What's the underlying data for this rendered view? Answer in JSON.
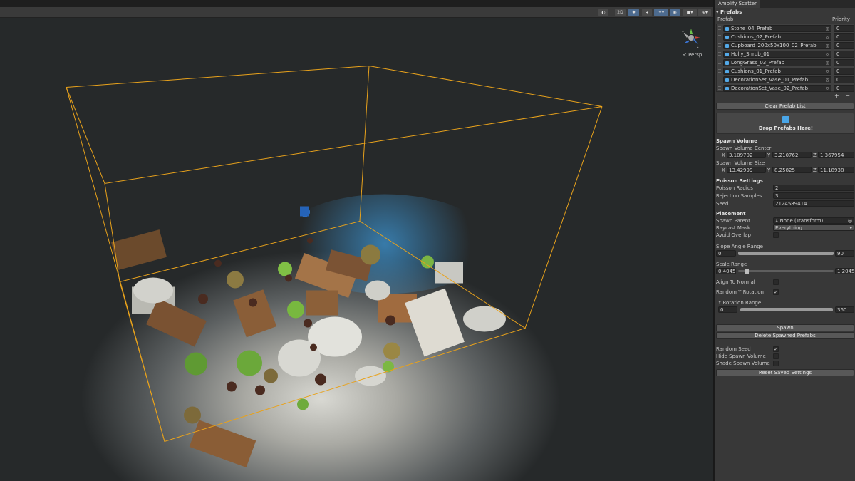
{
  "scene": {
    "toolbar": {
      "mode_2d": "2D"
    },
    "persp_label": "≺ Persp",
    "gizmo_axes": {
      "y": "y",
      "z": "z"
    }
  },
  "panel": {
    "tab_title": "Amplify Scatter",
    "prefabs": {
      "foldout_label": "Prefabs",
      "col_prefab": "Prefab",
      "col_priority": "Priority",
      "items": [
        {
          "name": "Stone_04_Prefab",
          "priority": "0"
        },
        {
          "name": "Cushions_02_Prefab",
          "priority": "0"
        },
        {
          "name": "Cupboard_200x50x100_02_Prefab",
          "priority": "0"
        },
        {
          "name": "Holly_Shrub_01",
          "priority": "0"
        },
        {
          "name": "LongGrass_03_Prefab",
          "priority": "0"
        },
        {
          "name": "Cushions_01_Prefab",
          "priority": "0"
        },
        {
          "name": "DecorationSet_Vase_01_Prefab",
          "priority": "0"
        },
        {
          "name": "DecorationSet_Vase_02_Prefab",
          "priority": "0"
        }
      ],
      "add_label": "+",
      "remove_label": "−",
      "clear_label": "Clear Prefab List",
      "drop_label": "Drop Prefabs Here!"
    },
    "spawn_volume": {
      "header": "Spawn Volume",
      "center_label": "Spawn Volume Center",
      "center": {
        "x": "3.109702",
        "y": "3.210762",
        "z": "1.367954"
      },
      "size_label": "Spawn Volume Size",
      "size": {
        "x": "13.42999",
        "y": "8.25825",
        "z": "11.18938"
      },
      "axis_x": "X",
      "axis_y": "Y",
      "axis_z": "Z"
    },
    "poisson": {
      "header": "Poisson Settings",
      "radius_label": "Poisson Radius",
      "radius": "2",
      "rejection_label": "Rejection Samples",
      "rejection": "3",
      "seed_label": "Seed",
      "seed": "2124589414"
    },
    "placement": {
      "header": "Placement",
      "parent_label": "Spawn Parent",
      "parent_value": "None (Transform)",
      "raycast_label": "Raycast Mask",
      "raycast_value": "Everything",
      "avoid_label": "Avoid Overlap",
      "slope_label": "Slope Angle Range",
      "slope_min": "0",
      "slope_max": "90",
      "scale_label": "Scale Range",
      "scale_min": "0.40457",
      "scale_max": "1.204573",
      "align_label": "Align To Normal",
      "random_y_label": "Random Y Rotation",
      "y_range_label": "Y Rotation Range",
      "y_min": "0",
      "y_max": "360"
    },
    "actions": {
      "spawn": "Spawn",
      "delete": "Delete Spawned Prefabs",
      "random_seed_label": "Random Seed",
      "hide_label": "Hide Spawn Volume",
      "shade_label": "Shade Spawn Volume",
      "reset": "Reset Saved Settings"
    },
    "check_mark": "✓"
  },
  "colors": {
    "accent": "#4d6b8f",
    "volume_box": "#e8a21c",
    "prefab_icon": "#53a9e8"
  }
}
